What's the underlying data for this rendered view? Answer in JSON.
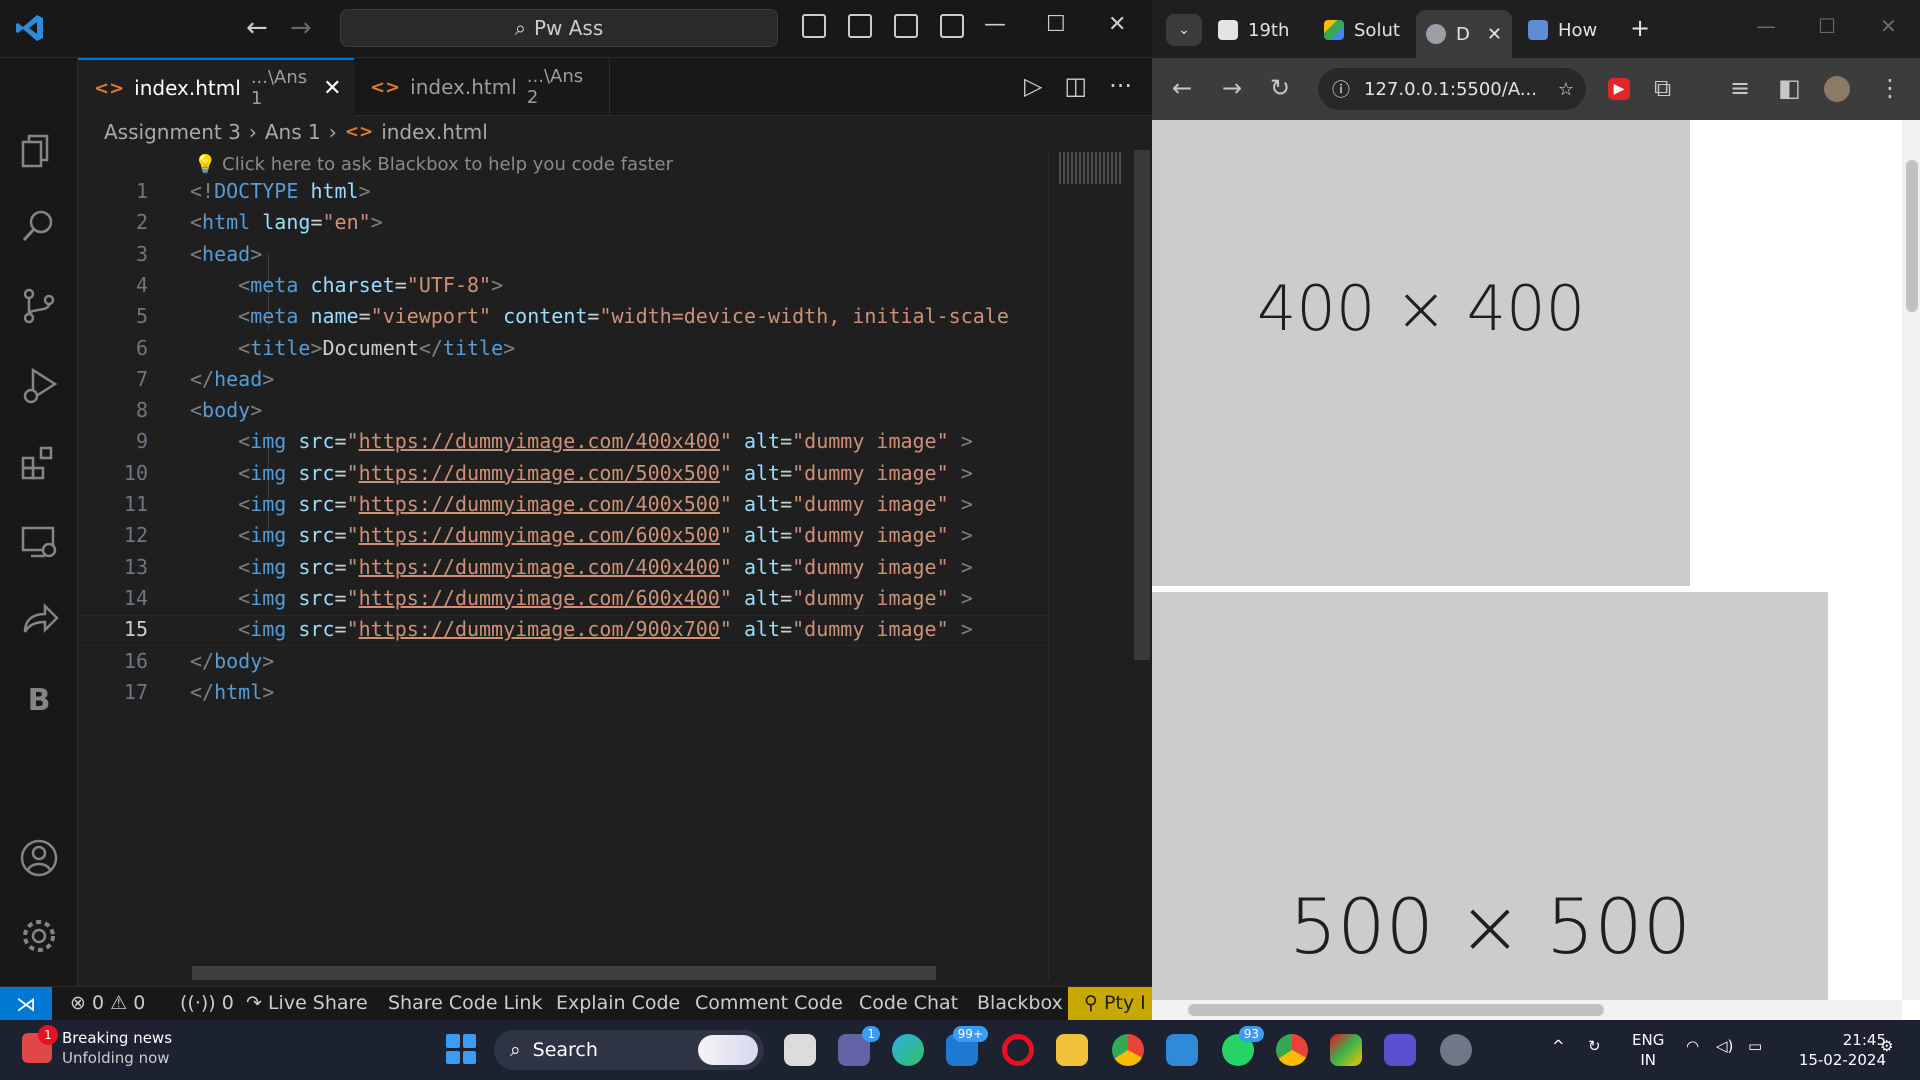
{
  "vscode": {
    "command_center": "Pw Ass",
    "tabs": [
      {
        "name": "index.html",
        "path": "...\\Ans 1",
        "active": true
      },
      {
        "name": "index.html",
        "path": "...\\Ans 2",
        "active": false
      }
    ],
    "breadcrumb": [
      "Assignment 3",
      "Ans 1",
      "index.html"
    ],
    "codelens": "Click here to ask Blackbox to help you code faster",
    "current_line": 15,
    "code_lines": [
      {
        "n": "1",
        "tokens": [
          [
            "br",
            "<!"
          ],
          [
            "tag",
            "DOCTYPE"
          ],
          [
            "txt",
            " "
          ],
          [
            "attr",
            "html"
          ],
          [
            "br",
            ">"
          ]
        ]
      },
      {
        "n": "2",
        "tokens": [
          [
            "br",
            "<"
          ],
          [
            "tag",
            "html"
          ],
          [
            "txt",
            " "
          ],
          [
            "attr",
            "lang"
          ],
          [
            "txt",
            "="
          ],
          [
            "str",
            "\"en\""
          ],
          [
            "br",
            ">"
          ]
        ]
      },
      {
        "n": "3",
        "tokens": [
          [
            "br",
            "<"
          ],
          [
            "tag",
            "head"
          ],
          [
            "br",
            ">"
          ]
        ]
      },
      {
        "n": "4",
        "tokens": [
          [
            "txt",
            "    "
          ],
          [
            "br",
            "<"
          ],
          [
            "tag",
            "meta"
          ],
          [
            "txt",
            " "
          ],
          [
            "attr",
            "charset"
          ],
          [
            "txt",
            "="
          ],
          [
            "str",
            "\"UTF-8\""
          ],
          [
            "br",
            ">"
          ]
        ]
      },
      {
        "n": "5",
        "tokens": [
          [
            "txt",
            "    "
          ],
          [
            "br",
            "<"
          ],
          [
            "tag",
            "meta"
          ],
          [
            "txt",
            " "
          ],
          [
            "attr",
            "name"
          ],
          [
            "txt",
            "="
          ],
          [
            "str",
            "\"viewport\""
          ],
          [
            "txt",
            " "
          ],
          [
            "attr",
            "content"
          ],
          [
            "txt",
            "="
          ],
          [
            "str",
            "\"width=device-width, initial-scale"
          ]
        ]
      },
      {
        "n": "6",
        "tokens": [
          [
            "txt",
            "    "
          ],
          [
            "br",
            "<"
          ],
          [
            "tag",
            "title"
          ],
          [
            "br",
            ">"
          ],
          [
            "txt",
            "Document"
          ],
          [
            "br",
            "</"
          ],
          [
            "tag",
            "title"
          ],
          [
            "br",
            ">"
          ]
        ]
      },
      {
        "n": "7",
        "tokens": [
          [
            "br",
            "</"
          ],
          [
            "tag",
            "head"
          ],
          [
            "br",
            ">"
          ]
        ]
      },
      {
        "n": "8",
        "tokens": [
          [
            "br",
            "<"
          ],
          [
            "tag",
            "body"
          ],
          [
            "br",
            ">"
          ]
        ]
      },
      {
        "n": "9",
        "tokens": [
          [
            "txt",
            "    "
          ],
          [
            "br",
            "<"
          ],
          [
            "tag",
            "img"
          ],
          [
            "txt",
            " "
          ],
          [
            "attr",
            "src"
          ],
          [
            "txt",
            "="
          ],
          [
            "str",
            "\""
          ],
          [
            "url",
            "https://dummyimage.com/400x400"
          ],
          [
            "str",
            "\""
          ],
          [
            "txt",
            " "
          ],
          [
            "attr",
            "alt"
          ],
          [
            "txt",
            "="
          ],
          [
            "str",
            "\"dummy image\""
          ],
          [
            "txt",
            " "
          ],
          [
            "br",
            ">"
          ]
        ]
      },
      {
        "n": "10",
        "tokens": [
          [
            "txt",
            "    "
          ],
          [
            "br",
            "<"
          ],
          [
            "tag",
            "img"
          ],
          [
            "txt",
            " "
          ],
          [
            "attr",
            "src"
          ],
          [
            "txt",
            "="
          ],
          [
            "str",
            "\""
          ],
          [
            "url",
            "https://dummyimage.com/500x500"
          ],
          [
            "str",
            "\""
          ],
          [
            "txt",
            " "
          ],
          [
            "attr",
            "alt"
          ],
          [
            "txt",
            "="
          ],
          [
            "str",
            "\"dummy image\""
          ],
          [
            "txt",
            " "
          ],
          [
            "br",
            ">"
          ]
        ]
      },
      {
        "n": "11",
        "tokens": [
          [
            "txt",
            "    "
          ],
          [
            "br",
            "<"
          ],
          [
            "tag",
            "img"
          ],
          [
            "txt",
            " "
          ],
          [
            "attr",
            "src"
          ],
          [
            "txt",
            "="
          ],
          [
            "str",
            "\""
          ],
          [
            "url",
            "https://dummyimage.com/400x500"
          ],
          [
            "str",
            "\""
          ],
          [
            "txt",
            " "
          ],
          [
            "attr",
            "alt"
          ],
          [
            "txt",
            "="
          ],
          [
            "str",
            "\"dummy image\""
          ],
          [
            "txt",
            " "
          ],
          [
            "br",
            ">"
          ]
        ]
      },
      {
        "n": "12",
        "tokens": [
          [
            "txt",
            "    "
          ],
          [
            "br",
            "<"
          ],
          [
            "tag",
            "img"
          ],
          [
            "txt",
            " "
          ],
          [
            "attr",
            "src"
          ],
          [
            "txt",
            "="
          ],
          [
            "str",
            "\""
          ],
          [
            "url",
            "https://dummyimage.com/600x500"
          ],
          [
            "str",
            "\""
          ],
          [
            "txt",
            " "
          ],
          [
            "attr",
            "alt"
          ],
          [
            "txt",
            "="
          ],
          [
            "str",
            "\"dummy image\""
          ],
          [
            "txt",
            " "
          ],
          [
            "br",
            ">"
          ]
        ]
      },
      {
        "n": "13",
        "tokens": [
          [
            "txt",
            "    "
          ],
          [
            "br",
            "<"
          ],
          [
            "tag",
            "img"
          ],
          [
            "txt",
            " "
          ],
          [
            "attr",
            "src"
          ],
          [
            "txt",
            "="
          ],
          [
            "str",
            "\""
          ],
          [
            "url",
            "https://dummyimage.com/400x400"
          ],
          [
            "str",
            "\""
          ],
          [
            "txt",
            " "
          ],
          [
            "attr",
            "alt"
          ],
          [
            "txt",
            "="
          ],
          [
            "str",
            "\"dummy image\""
          ],
          [
            "txt",
            " "
          ],
          [
            "br",
            ">"
          ]
        ]
      },
      {
        "n": "14",
        "tokens": [
          [
            "txt",
            "    "
          ],
          [
            "br",
            "<"
          ],
          [
            "tag",
            "img"
          ],
          [
            "txt",
            " "
          ],
          [
            "attr",
            "src"
          ],
          [
            "txt",
            "="
          ],
          [
            "str",
            "\""
          ],
          [
            "url",
            "https://dummyimage.com/600x400"
          ],
          [
            "str",
            "\""
          ],
          [
            "txt",
            " "
          ],
          [
            "attr",
            "alt"
          ],
          [
            "txt",
            "="
          ],
          [
            "str",
            "\"dummy image\""
          ],
          [
            "txt",
            " "
          ],
          [
            "br",
            ">"
          ]
        ]
      },
      {
        "n": "15",
        "tokens": [
          [
            "txt",
            "    "
          ],
          [
            "br",
            "<"
          ],
          [
            "tag",
            "img"
          ],
          [
            "txt",
            " "
          ],
          [
            "attr",
            "src"
          ],
          [
            "txt",
            "="
          ],
          [
            "str",
            "\""
          ],
          [
            "url",
            "https://dummyimage.com/900x700"
          ],
          [
            "str",
            "\""
          ],
          [
            "txt",
            " "
          ],
          [
            "attr",
            "alt"
          ],
          [
            "txt",
            "="
          ],
          [
            "str",
            "\"dummy image\""
          ],
          [
            "txt",
            " "
          ],
          [
            "br",
            ">"
          ]
        ]
      },
      {
        "n": "16",
        "tokens": [
          [
            "br",
            "</"
          ],
          [
            "tag",
            "body"
          ],
          [
            "br",
            ">"
          ]
        ]
      },
      {
        "n": "17",
        "tokens": [
          [
            "br",
            "</"
          ],
          [
            "tag",
            "html"
          ],
          [
            "br",
            ">"
          ]
        ]
      }
    ],
    "status": {
      "errors": "0",
      "warnings": "0",
      "ports": "0",
      "live_share": "Live Share",
      "share_code_link": "Share Code Link",
      "explain_code": "Explain Code",
      "comment_code": "Comment Code",
      "code_chat": "Code Chat",
      "blackbox": "Blackbox",
      "pty": "Pty I"
    },
    "activity_icons": [
      "explorer-icon",
      "search-icon",
      "source-control-icon",
      "run-debug-icon",
      "extensions-icon",
      "remote-explorer-icon",
      "live-share-icon",
      "blackbox-icon",
      "accounts-icon",
      "settings-icon"
    ]
  },
  "browser": {
    "tabs": [
      {
        "label": "19th",
        "color": "#2b2b2b"
      },
      {
        "label": "Solut",
        "color": "#34a853"
      },
      {
        "label": "D",
        "color": "#9aa0a6",
        "active": true
      },
      {
        "label": "How",
        "color": "#5f8dd3"
      }
    ],
    "url": "127.0.0.1:5500/A...",
    "images": [
      {
        "label": "400 × 400"
      },
      {
        "label": "500 × 500"
      }
    ]
  },
  "taskbar": {
    "news_title": "Breaking news",
    "news_sub": "Unfolding now",
    "news_badge": "1",
    "search": "Search",
    "teams_badge": "1",
    "mail_badge": "99+",
    "whatsapp_badge": "93",
    "lang": "ENG",
    "region": "IN",
    "time": "21:45",
    "date": "15-02-2024"
  }
}
